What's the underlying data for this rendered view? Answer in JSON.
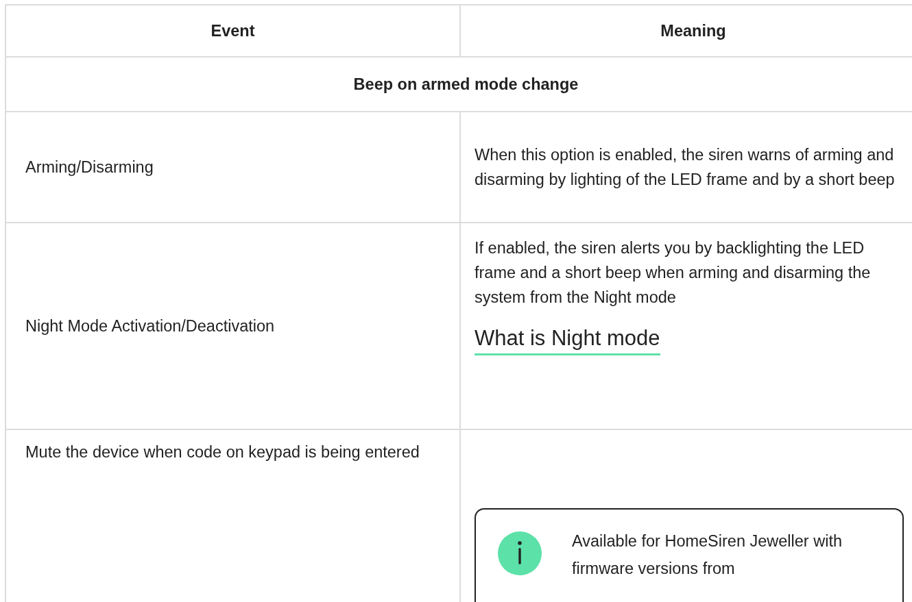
{
  "table": {
    "columns": [
      "Event",
      "Meaning"
    ],
    "section": "Beep on armed mode change",
    "rows": [
      {
        "event": "Arming/Disarming",
        "meaning": "When this option is enabled, the siren warns of arming and disarming by lighting of the LED frame and by a short beep"
      },
      {
        "event": "Night Mode Activation/Deactivation",
        "meaning": "If enabled, the siren alerts you by backlighting the LED frame and a short beep when arming and disarming the system from the Night mode",
        "link": "What is Night mode"
      },
      {
        "event": "Mute the device when code on keypad is being entered",
        "note": "Available for HomeSiren Jeweller with firmware versions from"
      }
    ]
  }
}
